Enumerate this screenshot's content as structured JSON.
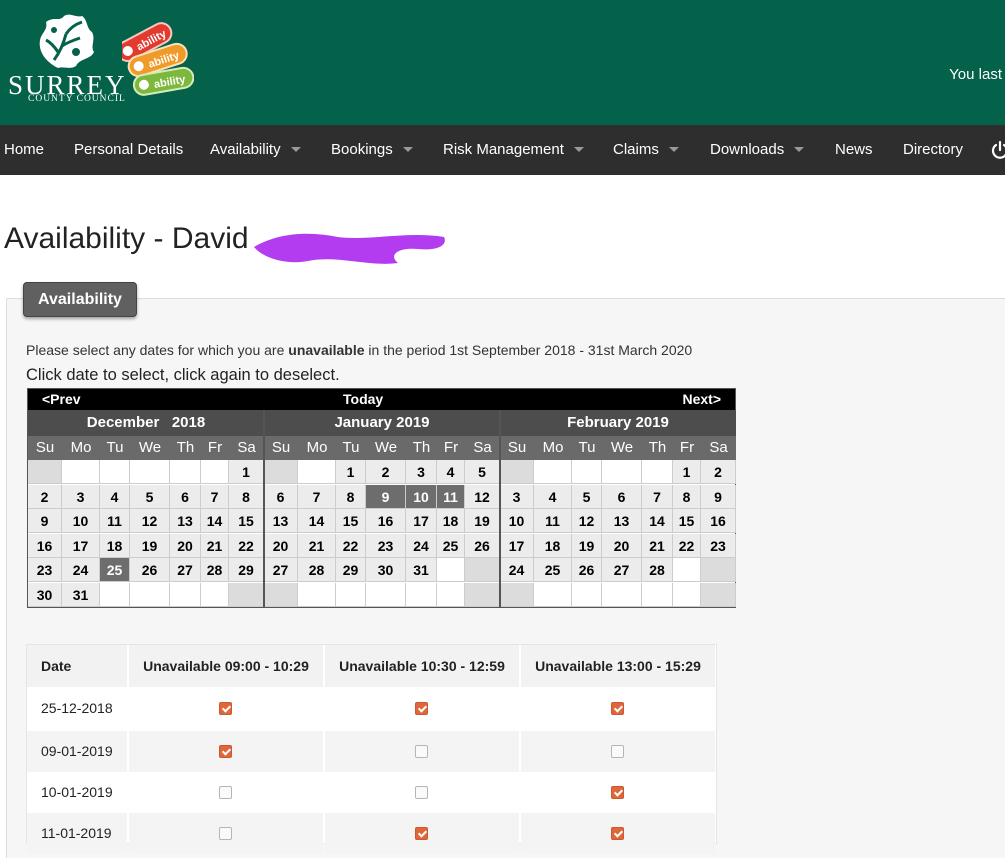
{
  "header": {
    "org_name": "SURREY",
    "org_sub": "COUNTY COUNCIL",
    "ability_logo_text": [
      "ability",
      "ability",
      "ability"
    ],
    "user_text": "You last",
    "background": "#04614a"
  },
  "nav": {
    "items": [
      {
        "label": "Home",
        "dropdown": false
      },
      {
        "label": "Personal Details",
        "dropdown": false
      },
      {
        "label": "Availability",
        "dropdown": true
      },
      {
        "label": "Bookings",
        "dropdown": true
      },
      {
        "label": "Risk Management",
        "dropdown": true
      },
      {
        "label": "Claims",
        "dropdown": true
      },
      {
        "label": "Downloads",
        "dropdown": true
      },
      {
        "label": "News",
        "dropdown": false
      },
      {
        "label": "Directory",
        "dropdown": false
      }
    ],
    "power_icon": "power-icon"
  },
  "page": {
    "title": "Availability - David"
  },
  "panel": {
    "tab_label": "Availability",
    "instruction_pre": "Please select any dates for which you are ",
    "instruction_bold": "unavailable",
    "instruction_post": " in the period 1st September 2018 - 31st March 2020",
    "instruction2": "Click date to select, click again to deselect."
  },
  "calendar": {
    "prev_label": "<Prev",
    "today_label": "Today",
    "next_label": "Next>",
    "day_headers": [
      "Su",
      "Mo",
      "Tu",
      "We",
      "Th",
      "Fr",
      "Sa"
    ],
    "months": [
      {
        "title": "December   2018",
        "weeks": [
          [
            "",
            "",
            "",
            "",
            "",
            "",
            "1"
          ],
          [
            "2",
            "3",
            "4",
            "5",
            "6",
            "7",
            "8"
          ],
          [
            "9",
            "10",
            "11",
            "12",
            "13",
            "14",
            "15"
          ],
          [
            "16",
            "17",
            "18",
            "19",
            "20",
            "21",
            "22"
          ],
          [
            "23",
            "24",
            "25",
            "26",
            "27",
            "28",
            "29"
          ],
          [
            "30",
            "31",
            "",
            "",
            "",
            "",
            ""
          ]
        ],
        "selected": [
          "25"
        ]
      },
      {
        "title": "January 2019",
        "weeks": [
          [
            "",
            "",
            "1",
            "2",
            "3",
            "4",
            "5"
          ],
          [
            "6",
            "7",
            "8",
            "9",
            "10",
            "11",
            "12"
          ],
          [
            "13",
            "14",
            "15",
            "16",
            "17",
            "18",
            "19"
          ],
          [
            "20",
            "21",
            "22",
            "23",
            "24",
            "25",
            "26"
          ],
          [
            "27",
            "28",
            "29",
            "30",
            "31",
            "",
            ""
          ],
          [
            "",
            "",
            "",
            "",
            "",
            "",
            ""
          ]
        ],
        "selected": [
          "9",
          "10",
          "11"
        ]
      },
      {
        "title": "February 2019",
        "weeks": [
          [
            "",
            "",
            "",
            "",
            "",
            "1",
            "2"
          ],
          [
            "3",
            "4",
            "5",
            "6",
            "7",
            "8",
            "9"
          ],
          [
            "10",
            "11",
            "12",
            "13",
            "14",
            "15",
            "16"
          ],
          [
            "17",
            "18",
            "19",
            "20",
            "21",
            "22",
            "23"
          ],
          [
            "24",
            "25",
            "26",
            "27",
            "28",
            "",
            ""
          ],
          [
            "",
            "",
            "",
            "",
            "",
            "",
            ""
          ]
        ],
        "selected": []
      }
    ]
  },
  "table": {
    "headers": [
      "Date",
      "Unavailable 09:00 - 10:29",
      "Unavailable 10:30 - 12:59",
      "Unavailable 13:00 - 15:29"
    ],
    "rows": [
      {
        "date": "25-12-2018",
        "checks": [
          true,
          true,
          true
        ]
      },
      {
        "date": "09-01-2019",
        "checks": [
          true,
          false,
          false
        ]
      },
      {
        "date": "10-01-2019",
        "checks": [
          false,
          false,
          true
        ]
      },
      {
        "date": "11-01-2019",
        "checks": [
          false,
          true,
          true
        ]
      }
    ],
    "checked_color": "#e0673b"
  }
}
